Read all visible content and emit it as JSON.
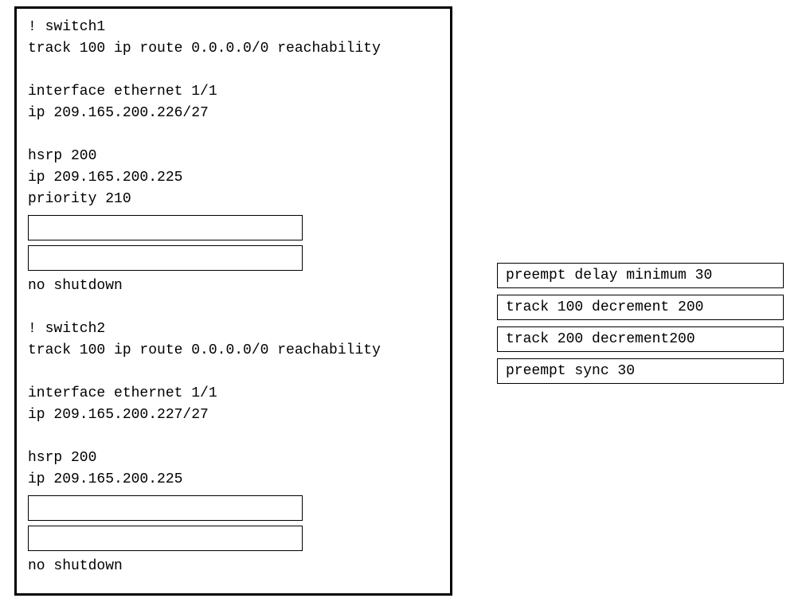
{
  "config": {
    "switch1": {
      "comment": "! switch1",
      "track": "track 100 ip route 0.0.0.0/0 reachability",
      "interface": "interface ethernet 1/1",
      "ip_if": "ip 209.165.200.226/27",
      "hsrp": "hsrp 200",
      "hsrp_ip": "ip 209.165.200.225",
      "priority": "priority 210",
      "no_shutdown": "no shutdown"
    },
    "switch2": {
      "comment": "! switch2",
      "track": "track 100 ip route 0.0.0.0/0 reachability",
      "interface": "interface ethernet 1/1",
      "ip_if": "ip 209.165.200.227/27",
      "hsrp": "hsrp 200",
      "hsrp_ip": "ip 209.165.200.225",
      "no_shutdown": "no shutdown"
    }
  },
  "options": [
    "preempt delay minimum 30",
    "track 100 decrement 200",
    "track 200 decrement200",
    "preempt sync 30"
  ]
}
